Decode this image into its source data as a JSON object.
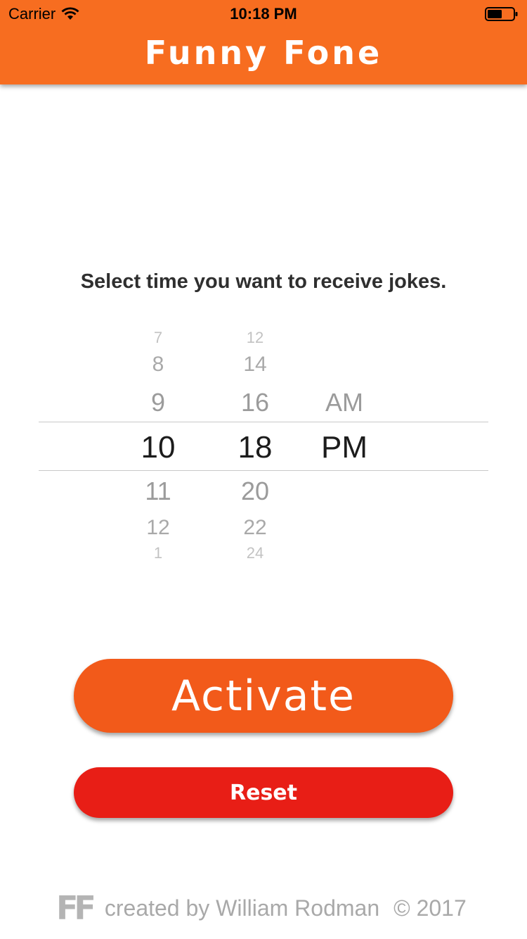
{
  "status_bar": {
    "carrier": "Carrier",
    "time": "10:18 PM"
  },
  "header": {
    "title": "Funny Fone"
  },
  "prompt": "Select time you want to receive jokes.",
  "picker": {
    "hours": [
      "7",
      "8",
      "9",
      "10",
      "11",
      "12",
      "1"
    ],
    "minutes": [
      "12",
      "14",
      "16",
      "18",
      "20",
      "22",
      "24"
    ],
    "period": [
      "AM",
      "PM"
    ],
    "selected": {
      "hour": "10",
      "minute": "18",
      "period": "PM"
    }
  },
  "buttons": {
    "activate": "Activate",
    "reset": "Reset"
  },
  "footer": {
    "logo": "FF",
    "credit": "created by William Rodman",
    "copyright": "© 2017"
  },
  "colors": {
    "header": "#f76d20",
    "activate": "#f25a1a",
    "reset": "#e81e16"
  }
}
